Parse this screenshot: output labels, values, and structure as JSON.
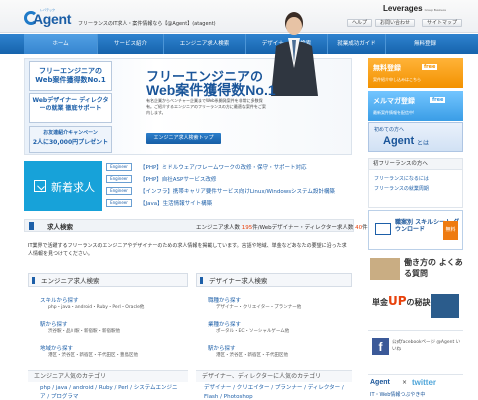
{
  "header": {
    "logo_kana": "レバテック",
    "logo_word": "Agent",
    "tagline": "フリーランスのIT求人・案件情報なら【@Agent】(atagent)",
    "brand": "Leverages",
    "brand_sub": "Group Business",
    "links": [
      "ヘルプ",
      "お問い合わせ",
      "サイトマップ"
    ]
  },
  "nav": [
    "ホーム",
    "サービス紹介",
    "エンジニア求人検索",
    "デザイナー求人検索",
    "就業成功ガイド",
    "無料登録"
  ],
  "hero": {
    "panel1": "フリーエンジニアの Web案件獲得数No.1",
    "panel2": "Webデザイナー ディレクターの就業 徹底サポート",
    "panel3_line": "お友達紹介キャンペーン",
    "panel3_bold": "2人に30,000円プレゼント",
    "title1": "フリーエンジニアの",
    "title2": "Web案件獲得数No.1",
    "desc": "有名企業からベンチャー企業までWeb系開発案件を非常に多数保有。ご紹介するエンジニアのフリーランスの方に最適な案件をご案内します。",
    "button": "エンジニア求人検索トップ"
  },
  "side_banners": {
    "register_title": "無料登録",
    "register_tag": "free",
    "register_sub": "案件紹介申し込みはこちら",
    "mail_title": "メルマガ登録",
    "mail_tag": "free",
    "mail_sub": "最新案件情報を配信中!",
    "first_small": "初めての方へ",
    "first_logo": "Agent",
    "first_to": "とは"
  },
  "new_jobs": {
    "label": "新着求人",
    "items": [
      {
        "tag": "Engineer",
        "title": "【PHP】ミドルウェア/フレームワークの改修・保守・サポート対応"
      },
      {
        "tag": "Engineer",
        "title": "【PHP】自社ASPサービス改修"
      },
      {
        "tag": "Engineer",
        "title": "【インフラ】携帯キャリア要件サービス向けLinux/Windowsシステム設計構築"
      },
      {
        "tag": "Engineer",
        "title": "【Java】生活情報サイト構築"
      }
    ]
  },
  "first_visit": {
    "title": "初フリーランスの方へ",
    "links": [
      "フリーランスになるには",
      "フリーランスの就業周期"
    ]
  },
  "search": {
    "title": "求人検索",
    "count_label": "エンジニア求人数",
    "engineer_count": "195",
    "count_mid": "件/Webデザイナー・ディレクター求人数",
    "designer_count": "40",
    "count_unit": "件",
    "intro": "IT業界で活躍するフリーランスのエンジニアやデザイナーのための求人情報を掲載しています。言語や地域、単金などあなたの要望に沿った求人情報を見つけてください。"
  },
  "engineer_col": {
    "title": "エンジニア求人検索",
    "subs": [
      {
        "title": "スキルから探す",
        "desc": "php・java・android・Ruby・Perl・Oracle他"
      },
      {
        "title": "駅から探す",
        "desc": "渋谷駅・品川駅・新宿駅・新宿駅他"
      },
      {
        "title": "地域から探す",
        "desc": "港区・渋谷区・新宿区・千代田区・豊島区他"
      }
    ],
    "popular": "エンジニア人気のカテゴリ",
    "tags": "php / java / android / Ruby / Perl / システムエンジニア / プログラマ"
  },
  "designer_col": {
    "title": "デザイナー求人検索",
    "subs": [
      {
        "title": "職種から探す",
        "desc": "デザイナー・クリエイター・プランナー他"
      },
      {
        "title": "業種から探す",
        "desc": "ポータル・EC・ソーシャルゲーム他"
      },
      {
        "title": "駅から探す",
        "desc": "港区・渋谷区・新宿区・千代田区他"
      }
    ],
    "popular": "デザイナー、ディレクターに人気のカテゴリ",
    "tags": "デザイナー / クリエイター / プランナー / ディレクター / Flash / Photoshop"
  },
  "right_lower": {
    "dl_title": "職案別 スキルシート ダウンロード",
    "dl_free": "無料",
    "work_title": "働き方の よくある質問",
    "up_pre": "単金",
    "up_big": "UP",
    "up_post": "の秘訣",
    "fb_text": "公式facebookページ @Agent いいね",
    "tw_agent": "Agent",
    "tw_x": "×",
    "tw_brand": "twitter",
    "tw_sub": "IT・Web情報つぶやき中"
  }
}
